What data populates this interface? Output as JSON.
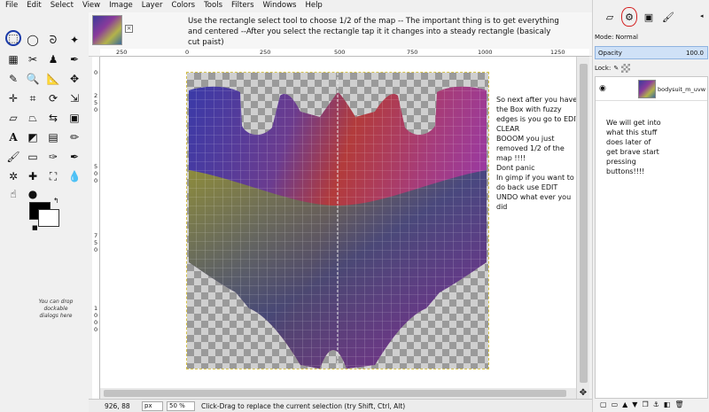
{
  "menu": [
    "File",
    "Edit",
    "Select",
    "View",
    "Image",
    "Layer",
    "Colors",
    "Tools",
    "Filters",
    "Windows",
    "Help"
  ],
  "instruction": "Use the rectangle select tool to choose 1/2 of the map -- The important thing is to get everything and centered --After you select the rectangle tap it it changes into a steady rectangle (basicaly cut paist)",
  "tab_close_icon": "close-icon",
  "rulers": {
    "top": [
      "250",
      "0",
      "250",
      "500",
      "750",
      "1000",
      "1250"
    ],
    "left": [
      "0",
      "2",
      "5",
      "0",
      "5",
      "0",
      "0",
      "7",
      "5",
      "0",
      "1",
      "0",
      "0",
      "0"
    ]
  },
  "note_left": "So next after you have the Box with fuzzy edges is you go to EDIT CLEAR\nBOOOM you just removed 1/2 of the map !!!!\nDont panic\nIn gimp if you want to do back use EDIT UNDO what ever you did",
  "note_right": "We will get into what this stuff does later of get brave start pressing buttons!!!!",
  "toolbox": {
    "drop_note": "You can drop dockable dialogs here",
    "foreground_color": "#000000",
    "background_color": "#ffffff"
  },
  "status": {
    "coords": "926, 88",
    "unit": "px",
    "zoom": "50 %",
    "message": "Click-Drag to replace the current selection (try Shift, Ctrl, Alt)"
  },
  "dock": {
    "mode_label": "Mode: Normal",
    "opacity_label": "Opacity",
    "opacity_value": "100.0",
    "lock_label": "Lock:",
    "layer_name": "bodysuit_m_uvw"
  },
  "colors": {
    "highlight_circle": "#d42020",
    "active_tool_circle": "#1a3aa8",
    "selection_marquee": "#d4c14a"
  }
}
